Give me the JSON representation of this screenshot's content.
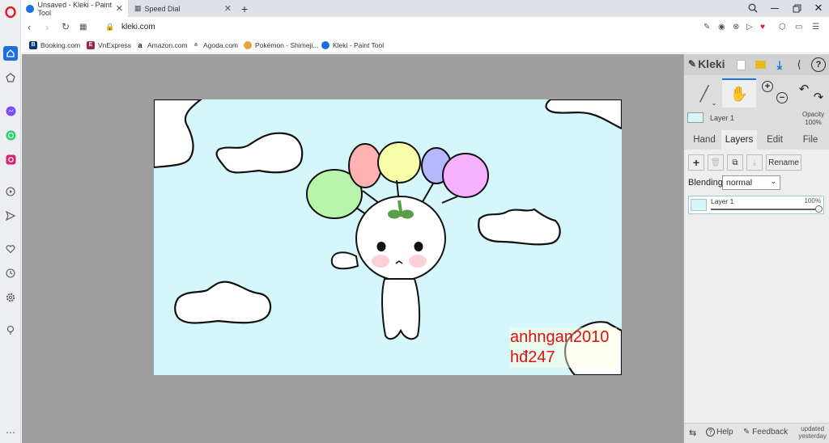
{
  "browser": {
    "tabs": [
      {
        "title": "Unsaved - Kleki - Paint Tool",
        "active": true
      },
      {
        "title": "Speed Dial",
        "active": false
      }
    ],
    "new_tab": "+",
    "address": "kleki.com",
    "bookmarks": [
      "Booking.com",
      "VnExpress",
      "Amazon.com",
      "Agoda.com",
      "Pokémon - Shimeji...",
      "Kleki - Paint Tool"
    ]
  },
  "kleki": {
    "logo": "Kleki",
    "layer_name": "Layer 1",
    "opacity_label": "Opacity",
    "opacity_value": "100%",
    "tabs": [
      "Hand",
      "Layers",
      "Edit",
      "File"
    ],
    "active_tab": "Layers",
    "rename_label": "Rename",
    "blending_label": "Blending",
    "blending_value": "normal",
    "layer_item": {
      "name": "Layer 1",
      "opacity": "100%",
      "opacity_fraction": 1.0
    },
    "footer": {
      "help": "Help",
      "feedback": "Feedback",
      "updated_line1": "updated",
      "updated_line2": "yesterday"
    }
  },
  "canvas": {
    "watermark_line1": "anhngan2010",
    "watermark_line2": "hđ247"
  },
  "colors": {
    "accent": "#1d6fe0",
    "opera_red": "#e21b23",
    "canvas_bg": "#d5f7fb",
    "workspace": "#9e9e9e",
    "watermark": "#d11111"
  }
}
